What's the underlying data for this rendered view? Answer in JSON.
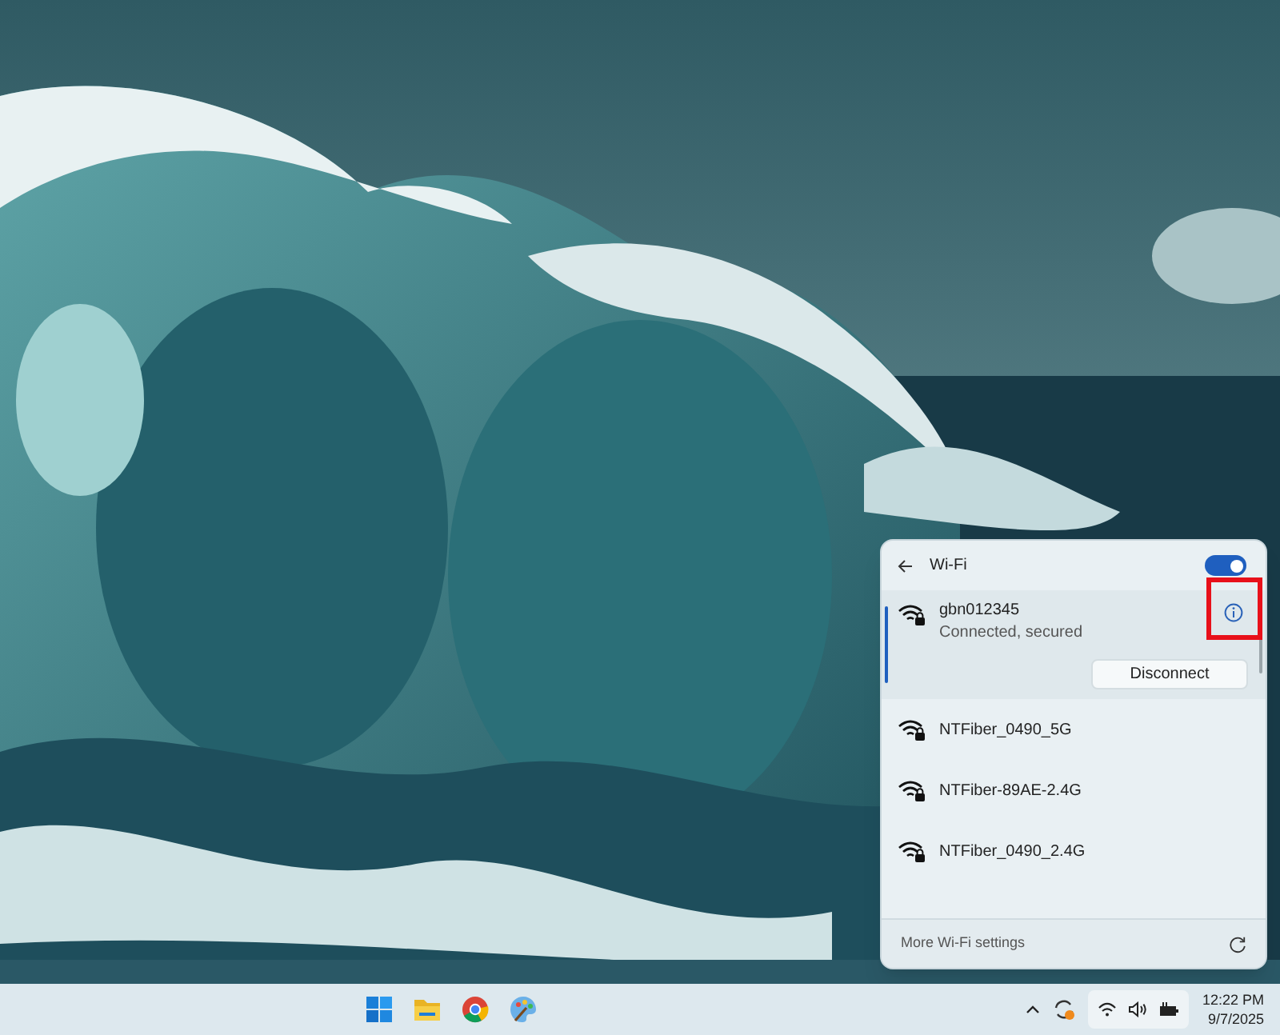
{
  "wifi_panel": {
    "title": "Wi-Fi",
    "wifi_on": true,
    "networks": [
      {
        "name": "gbn012345",
        "status": "Connected, secured",
        "selected": true,
        "action": "Disconnect"
      },
      {
        "name": "NTFiber_0490_5G",
        "selected": false
      },
      {
        "name": "NTFiber-89AE-2.4G",
        "selected": false
      },
      {
        "name": "NTFiber_0490_2.4G",
        "selected": false
      }
    ],
    "footer": "More Wi-Fi settings"
  },
  "annotation": {
    "highlight": true
  },
  "taskbar": {
    "apps": [
      {
        "kind": "start"
      },
      {
        "kind": "files"
      },
      {
        "kind": "browser"
      },
      {
        "kind": "paint"
      }
    ],
    "clock": {
      "time": "12:22 PM",
      "date": "9/7/2025"
    }
  }
}
